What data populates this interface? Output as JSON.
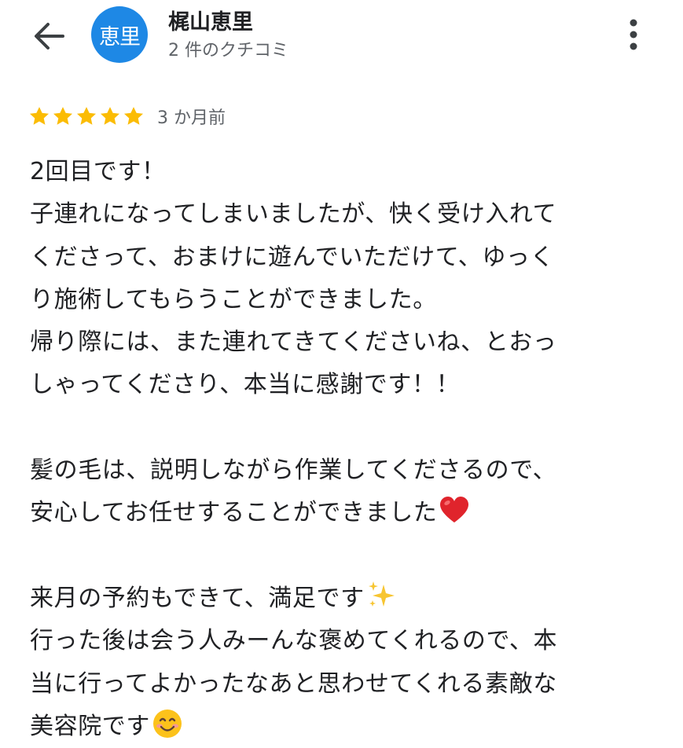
{
  "header": {
    "back_icon": "arrow-left-icon",
    "avatar_text": "恵里",
    "avatar_color": "#1e88e5",
    "reviewer_name": "梶山恵里",
    "review_count": "2 件のクチコミ",
    "more_icon": "more-vertical-icon"
  },
  "review": {
    "rating": 5,
    "rating_max": 5,
    "star_color": "#fbbc04",
    "time_ago": "3 か月前",
    "lines": [
      "2回目です！",
      "子連れになってしまいましたが、快く受け入れて",
      "くださって、おまけに遊んでいただけて、ゆっく",
      "り施術してもらうことができました。",
      "帰り際には、また連れてきてくださいね、とおっ",
      "しゃってくださり、本当に感謝です！！",
      "",
      "髪の毛は、説明しながら作業してくださるので、",
      "安心してお任せすることができました",
      "",
      "来月の予約もできて、満足です",
      "行った後は会う人みーんな褒めてくれるので、本",
      "当に行ってよかったなあと思わせてくれる素敵な",
      "美容院です"
    ],
    "emojis": {
      "line_8": "red-heart-emoji",
      "line_10": "sparkles-emoji",
      "line_13": "smiling-face-emoji"
    }
  }
}
